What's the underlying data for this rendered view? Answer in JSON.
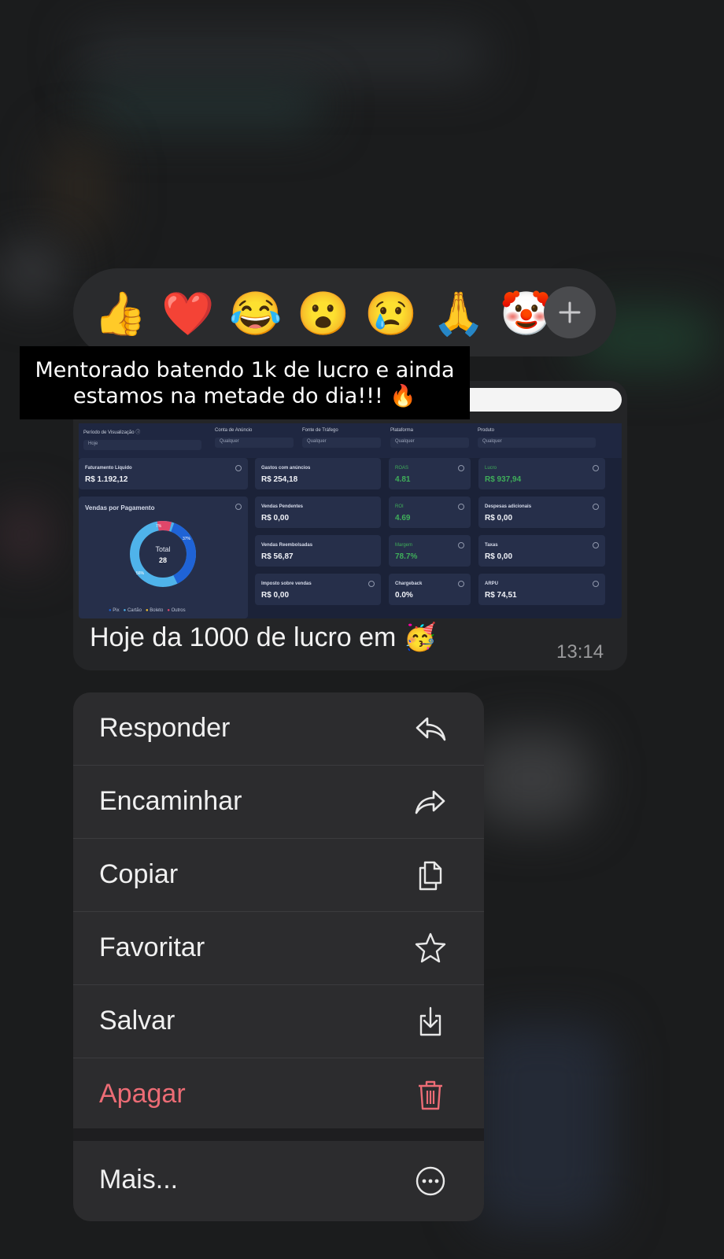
{
  "reactions": {
    "emojis": [
      "👍",
      "❤️",
      "😂",
      "😮",
      "😢",
      "🙏",
      "🤡"
    ],
    "more_icon": "plus-icon"
  },
  "caption": {
    "text": "Mentorado batendo 1k de lucro e ainda estamos na metade do dia!!! 🔥"
  },
  "dashboard": {
    "filters": [
      {
        "label": "Período de Visualização ⓘ",
        "value": "Hoje"
      },
      {
        "label": "Conta de Anúncio",
        "value": "Qualquer"
      },
      {
        "label": "Fonte de Tráfego",
        "value": "Qualquer"
      },
      {
        "label": "Plataforma",
        "value": "Qualquer"
      },
      {
        "label": "Produto",
        "value": "Qualquer"
      }
    ],
    "faturamento": {
      "label": "Faturamento Líquido",
      "value": "R$ 1.192,12"
    },
    "gastos": {
      "label": "Gastos com anúncios",
      "value": "R$ 254,18"
    },
    "roas": {
      "label": "ROAS",
      "value": "4.81"
    },
    "lucro": {
      "label": "Lucro",
      "value": "R$ 937,94"
    },
    "vendas_pagamento": {
      "title": "Vendas por Pagamento",
      "total_label": "Total",
      "total_value": "28",
      "pct_red": "7%",
      "pct_dark": "37%",
      "pct_light": "56%"
    },
    "vendas_pendentes": {
      "label": "Vendas Pendentes",
      "value": "R$ 0,00"
    },
    "roi": {
      "label": "ROI",
      "value": "4.69"
    },
    "despesas": {
      "label": "Despesas adicionais",
      "value": "R$ 0,00"
    },
    "reembolsadas": {
      "label": "Vendas Reembolsadas",
      "value": "R$ 56,87"
    },
    "margem": {
      "label": "Margem",
      "value": "78.7%"
    },
    "taxas": {
      "label": "Taxas",
      "value": "R$ 0,00"
    },
    "imposto": {
      "label": "Imposto sobre vendas",
      "value": "R$ 0,00"
    },
    "chargeback": {
      "label": "Chargeback",
      "value": "0.0%"
    },
    "arpu": {
      "label": "ARPU",
      "value": "R$ 74,51"
    },
    "legend": [
      "Pix",
      "Cartão",
      "Boleto",
      "Outros"
    ],
    "colors": {
      "pix": "#1f63d6",
      "cartao": "#4fb3ea",
      "boleto": "#f2c230",
      "outros": "#e0476a"
    }
  },
  "message": {
    "text": "Hoje da 1000 de lucro em 🥳",
    "time": "13:14"
  },
  "menu": {
    "items": [
      {
        "label": "Responder",
        "icon": "reply-icon"
      },
      {
        "label": "Encaminhar",
        "icon": "forward-icon"
      },
      {
        "label": "Copiar",
        "icon": "copy-icon"
      },
      {
        "label": "Favoritar",
        "icon": "star-icon"
      },
      {
        "label": "Salvar",
        "icon": "save-icon"
      },
      {
        "label": "Apagar",
        "icon": "trash-icon"
      }
    ],
    "more": {
      "label": "Mais...",
      "icon": "more-icon"
    },
    "danger_color": "#ec6c75"
  }
}
